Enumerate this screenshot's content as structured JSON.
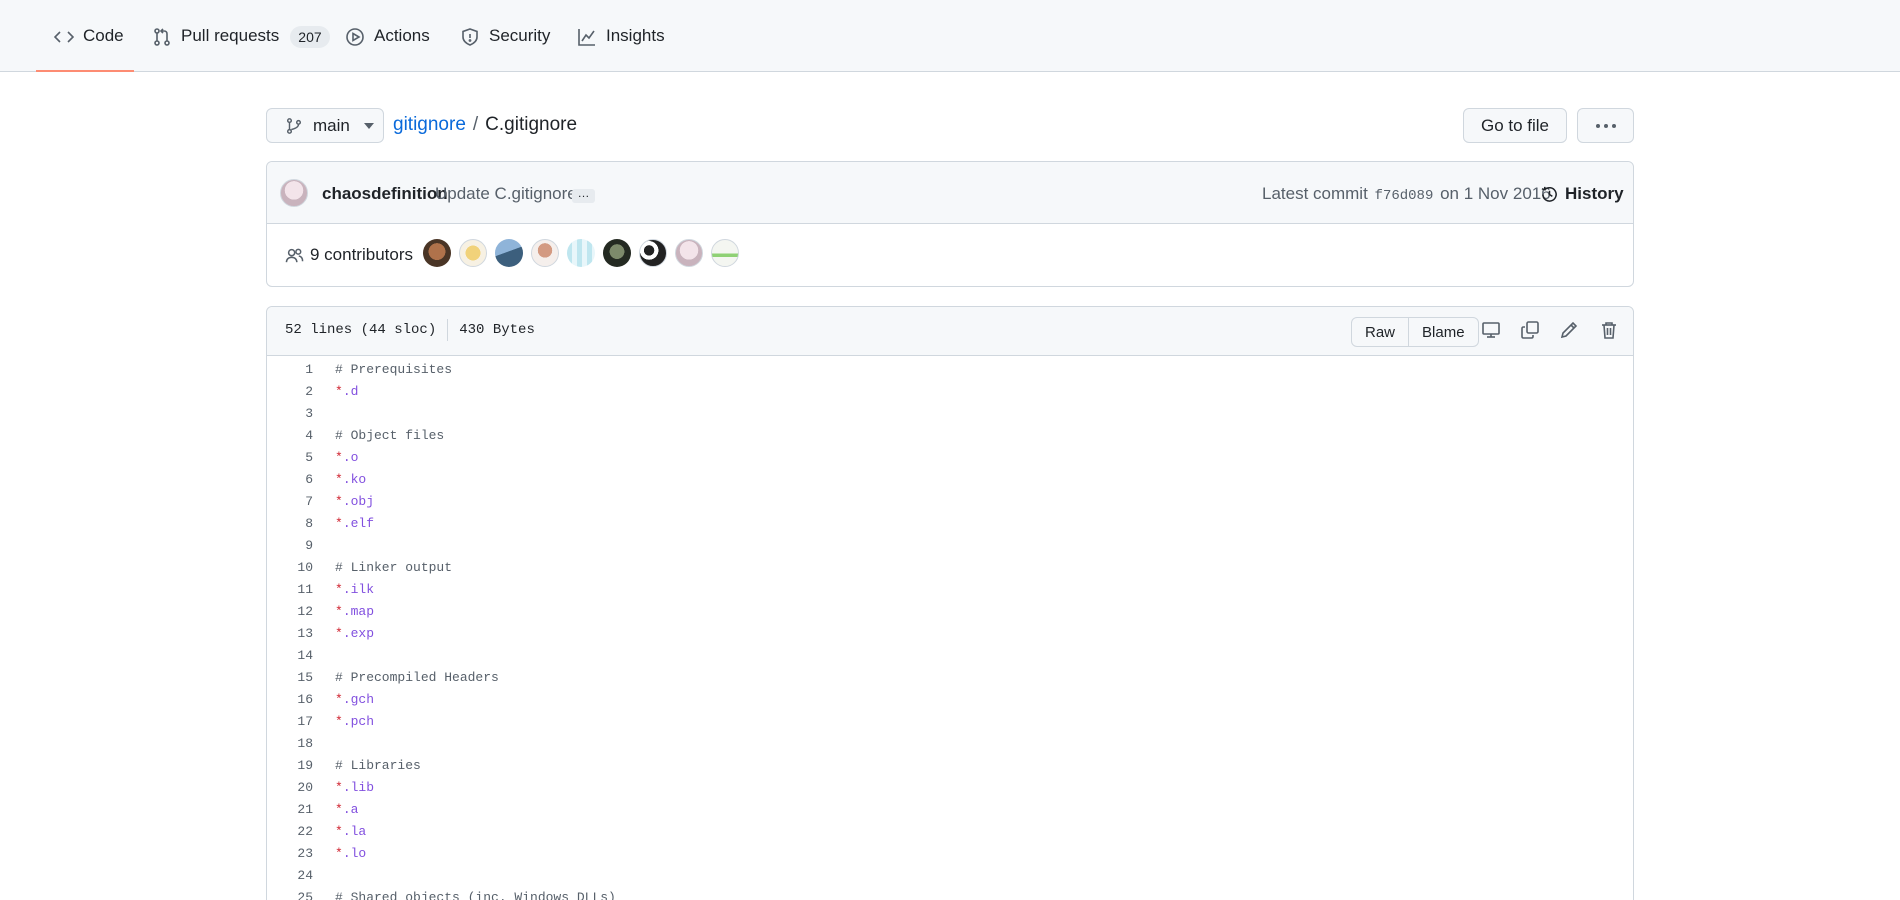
{
  "nav": {
    "tabs": [
      {
        "label": "Code",
        "icon": "code-icon"
      },
      {
        "label": "Pull requests",
        "icon": "pull-request-icon",
        "count": "207"
      },
      {
        "label": "Actions",
        "icon": "play-icon"
      },
      {
        "label": "Security",
        "icon": "shield-icon"
      },
      {
        "label": "Insights",
        "icon": "graph-icon"
      }
    ]
  },
  "breadcrumb": {
    "branch": "main",
    "repo": "gitignore",
    "separator": "/",
    "file": "C.gitignore"
  },
  "actions": {
    "go_to_file": "Go to file"
  },
  "commit": {
    "author": "chaosdefinition",
    "message": "Update C.gitignore",
    "ellipsis": "…",
    "latest_prefix": "Latest commit",
    "sha": "f76d089",
    "date_text": "on 1 Nov 2016",
    "history_label": "History",
    "contributors_label": "9 contributors"
  },
  "file": {
    "lines_info": "52 lines (44 sloc)",
    "size": "430 Bytes",
    "raw_label": "Raw",
    "blame_label": "Blame"
  },
  "colors": {
    "selected_tab_underline": "#fd8c73",
    "link": "#0969da",
    "comment": "#57606a",
    "star": "#cf222e",
    "ext": "#8250df"
  },
  "code_lines": [
    {
      "n": "1",
      "t": "comment",
      "text": "# Prerequisites"
    },
    {
      "n": "2",
      "t": "glob",
      "star": "*",
      "ext": ".d"
    },
    {
      "n": "3",
      "t": "blank",
      "text": ""
    },
    {
      "n": "4",
      "t": "comment",
      "text": "# Object files"
    },
    {
      "n": "5",
      "t": "glob",
      "star": "*",
      "ext": ".o"
    },
    {
      "n": "6",
      "t": "glob",
      "star": "*",
      "ext": ".ko"
    },
    {
      "n": "7",
      "t": "glob",
      "star": "*",
      "ext": ".obj"
    },
    {
      "n": "8",
      "t": "glob",
      "star": "*",
      "ext": ".elf"
    },
    {
      "n": "9",
      "t": "blank",
      "text": ""
    },
    {
      "n": "10",
      "t": "comment",
      "text": "# Linker output"
    },
    {
      "n": "11",
      "t": "glob",
      "star": "*",
      "ext": ".ilk"
    },
    {
      "n": "12",
      "t": "glob",
      "star": "*",
      "ext": ".map"
    },
    {
      "n": "13",
      "t": "glob",
      "star": "*",
      "ext": ".exp"
    },
    {
      "n": "14",
      "t": "blank",
      "text": ""
    },
    {
      "n": "15",
      "t": "comment",
      "text": "# Precompiled Headers"
    },
    {
      "n": "16",
      "t": "glob",
      "star": "*",
      "ext": ".gch"
    },
    {
      "n": "17",
      "t": "glob",
      "star": "*",
      "ext": ".pch"
    },
    {
      "n": "18",
      "t": "blank",
      "text": ""
    },
    {
      "n": "19",
      "t": "comment",
      "text": "# Libraries"
    },
    {
      "n": "20",
      "t": "glob",
      "star": "*",
      "ext": ".lib"
    },
    {
      "n": "21",
      "t": "glob",
      "star": "*",
      "ext": ".a"
    },
    {
      "n": "22",
      "t": "glob",
      "star": "*",
      "ext": ".la"
    },
    {
      "n": "23",
      "t": "glob",
      "star": "*",
      "ext": ".lo"
    },
    {
      "n": "24",
      "t": "blank",
      "text": ""
    },
    {
      "n": "25",
      "t": "comment",
      "text": "# Shared objects (inc. Windows DLLs)"
    }
  ]
}
